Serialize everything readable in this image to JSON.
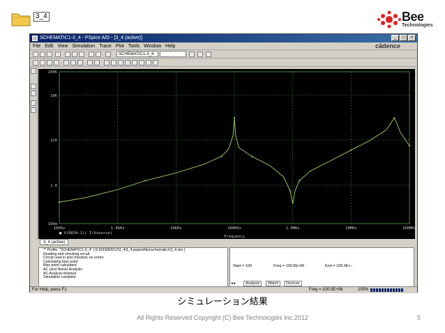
{
  "folder": {
    "label": "3_4"
  },
  "logo": {
    "brand": "Bee",
    "sub": "Technologies"
  },
  "window": {
    "title": "SCHEMATIC1-3_4 - PSpice A/D - [3_4 (active)]",
    "menu": [
      "File",
      "Edit",
      "View",
      "Simulation",
      "Trace",
      "Plot",
      "Tools",
      "Window",
      "Help"
    ],
    "cadence": "cādence",
    "profile": "SCHEMATIC1-3_4"
  },
  "plot": {
    "tab_label": "3_4 (active)",
    "xlabel": "Frequency",
    "trace_label": "■ V(R834:1)/ I(Vsource)",
    "yticks": [
      "100K",
      "10K",
      "120",
      "1.0",
      "100m"
    ],
    "xticks": [
      "100Hz",
      "1.0KHz",
      "10KHz",
      "100KHz",
      "1.0MHz",
      "10MHz",
      "100MHz"
    ],
    "colors": {
      "background": "#000000",
      "grid": "#3c8c3c",
      "trace": "#8fc35a"
    }
  },
  "chart_data": {
    "type": "line",
    "x_scale": "log",
    "y_scale": "log",
    "xlabel": "Frequency",
    "ylabel": "",
    "series": [
      {
        "name": "V(R834:1)/ I(Vsource)",
        "x": [
          100,
          300,
          1000,
          3000,
          10000,
          30000,
          60000,
          80000,
          95000,
          100000,
          105000,
          120000,
          200000,
          400000,
          700000,
          900000,
          1000000,
          1100000,
          1300000,
          2000000,
          5000000,
          10000000,
          20000000,
          40000000,
          55000000,
          60000000,
          70000000,
          100000000
        ],
        "y": [
          0.7,
          1.1,
          2.2,
          5,
          10,
          22,
          45,
          90,
          300,
          1500,
          300,
          100,
          45,
          20,
          7,
          2,
          0.6,
          2,
          5,
          12,
          35,
          80,
          180,
          500,
          1500,
          1000,
          400,
          120
        ]
      }
    ]
  },
  "output": {
    "lines": [
      "** Profile: \"SCHEMATIC1-3_4\"  [ D:\\0\\FEB2012\\3_4\\3_4-pspicefiles\\schematic1\\3_4.sim ]",
      "Reading and checking circuit",
      "Circuit read in and checked, no errors",
      "Calculating bias point",
      "Bias point calculated",
      "AC (and Noise) Analysis",
      "AC Analysis finished",
      "Simulation complete"
    ]
  },
  "sim": {
    "start": "Start = 100",
    "freq": "Freq = 100.0E+06",
    "end": "End = 100.0E+..",
    "tabs": [
      "Analysis",
      "Watch",
      "Devices"
    ]
  },
  "status": {
    "help": "For Help, press F1",
    "freq": "Freq = 100.0E+06",
    "pct": "100%"
  },
  "caption": "シミュレーション結果",
  "footer": "All Rights Reserved Copyright (C) Bee Technologies Inc.2012",
  "page_number": "5"
}
